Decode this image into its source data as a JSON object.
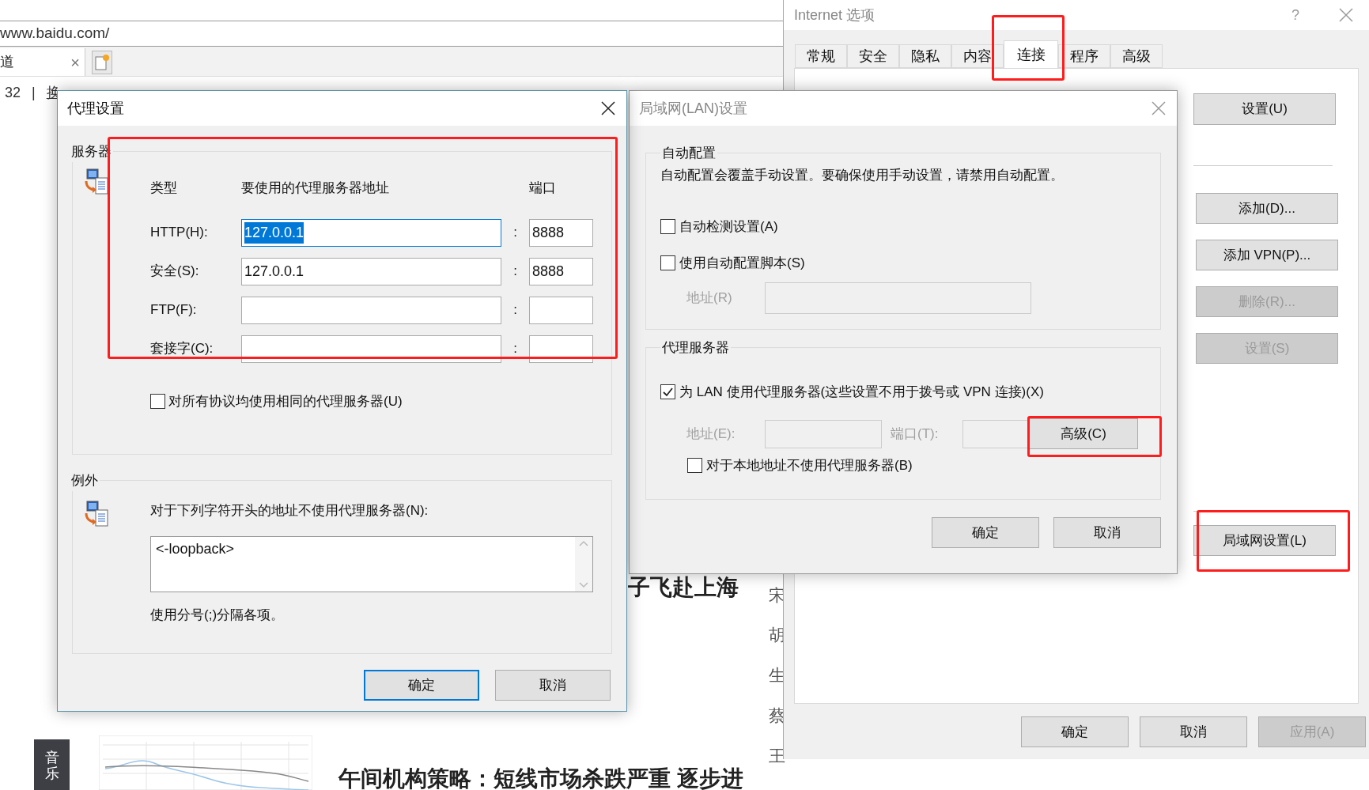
{
  "browser": {
    "address": "www.baidu.com/",
    "tab": {
      "title": "道",
      "close": "×"
    },
    "nav_text": [
      "32",
      "|",
      "换"
    ],
    "side_tag": "音乐",
    "headlines": [
      "子飞赴上海",
      "午间机构策略：短线市场杀跌严重 逐步进"
    ],
    "names": [
      "宋",
      "胡",
      "生",
      "蔡",
      "王"
    ]
  },
  "internet_options": {
    "title": "Internet 选项",
    "help": "?",
    "tabs": [
      {
        "label": "常规",
        "selected": false,
        "highlighted": false
      },
      {
        "label": "安全",
        "selected": false,
        "highlighted": false
      },
      {
        "label": "隐私",
        "selected": false,
        "highlighted": false
      },
      {
        "label": "内容",
        "selected": false,
        "highlighted": false
      },
      {
        "label": "连接",
        "selected": true,
        "highlighted": true
      },
      {
        "label": "程序",
        "selected": false,
        "highlighted": false
      },
      {
        "label": "高级",
        "selected": false,
        "highlighted": false
      }
    ],
    "setup_button": {
      "label": "设置(U)",
      "disabled": false
    },
    "vpn_buttons": [
      {
        "label": "添加(D)...",
        "disabled": false
      },
      {
        "label": "添加 VPN(P)...",
        "disabled": false
      },
      {
        "label": "删除(R)...",
        "disabled": true
      },
      {
        "label": "设置(S)",
        "disabled": true
      }
    ],
    "lan_button": {
      "label": "局域网设置(L)",
      "highlighted": true
    },
    "footer_buttons": [
      {
        "label": "确定",
        "disabled": false
      },
      {
        "label": "取消",
        "disabled": false
      },
      {
        "label": "应用(A)",
        "disabled": true
      }
    ]
  },
  "lan_dialog": {
    "title": "局域网(LAN)设置",
    "auto_config": {
      "legend": "自动配置",
      "description": "自动配置会覆盖手动设置。要确保使用手动设置，请禁用自动配置。",
      "options": [
        {
          "label": "自动检测设置(A)",
          "checked": false
        },
        {
          "label": "使用自动配置脚本(S)",
          "checked": false
        }
      ],
      "address": {
        "label": "地址(R)",
        "disabled": true
      }
    },
    "proxy": {
      "legend": "代理服务器",
      "use_proxy": {
        "label": "为 LAN 使用代理服务器(这些设置不用于拨号或 VPN 连接)(X)",
        "checked": true
      },
      "address": {
        "label": "地址(E):",
        "disabled": true
      },
      "port": {
        "label": "端口(T):",
        "disabled": true
      },
      "advanced": {
        "label": "高级(C)",
        "highlighted": true
      },
      "bypass_local": {
        "label": "对于本地地址不使用代理服务器(B)",
        "checked": false
      }
    },
    "buttons": [
      "确定",
      "取消"
    ]
  },
  "proxy_dialog": {
    "title": "代理设置",
    "servers": {
      "legend": "服务器",
      "highlighted": true,
      "headers": [
        "类型",
        "要使用的代理服务器地址",
        "端口"
      ],
      "rows": [
        {
          "label": "HTTP(H):",
          "address": "127.0.0.1",
          "separator": ":",
          "port": "8888",
          "text_selected": true
        },
        {
          "label": "安全(S):",
          "address": "127.0.0.1",
          "separator": ":",
          "port": "8888",
          "text_selected": false
        },
        {
          "label": "FTP(F):",
          "separator": ":"
        },
        {
          "label": "套接字(C):",
          "separator": ":"
        }
      ],
      "same_for_all": {
        "label": "对所有协议均使用相同的代理服务器(U)",
        "checked": false
      }
    },
    "exceptions": {
      "legend": "例外",
      "prompt": "对于下列字符开头的地址不使用代理服务器(N):",
      "value": "<-loopback>",
      "note": "使用分号(;)分隔各项。"
    },
    "buttons": [
      {
        "label": "确定",
        "focused": true
      },
      {
        "label": "取消",
        "focused": false
      }
    ]
  }
}
